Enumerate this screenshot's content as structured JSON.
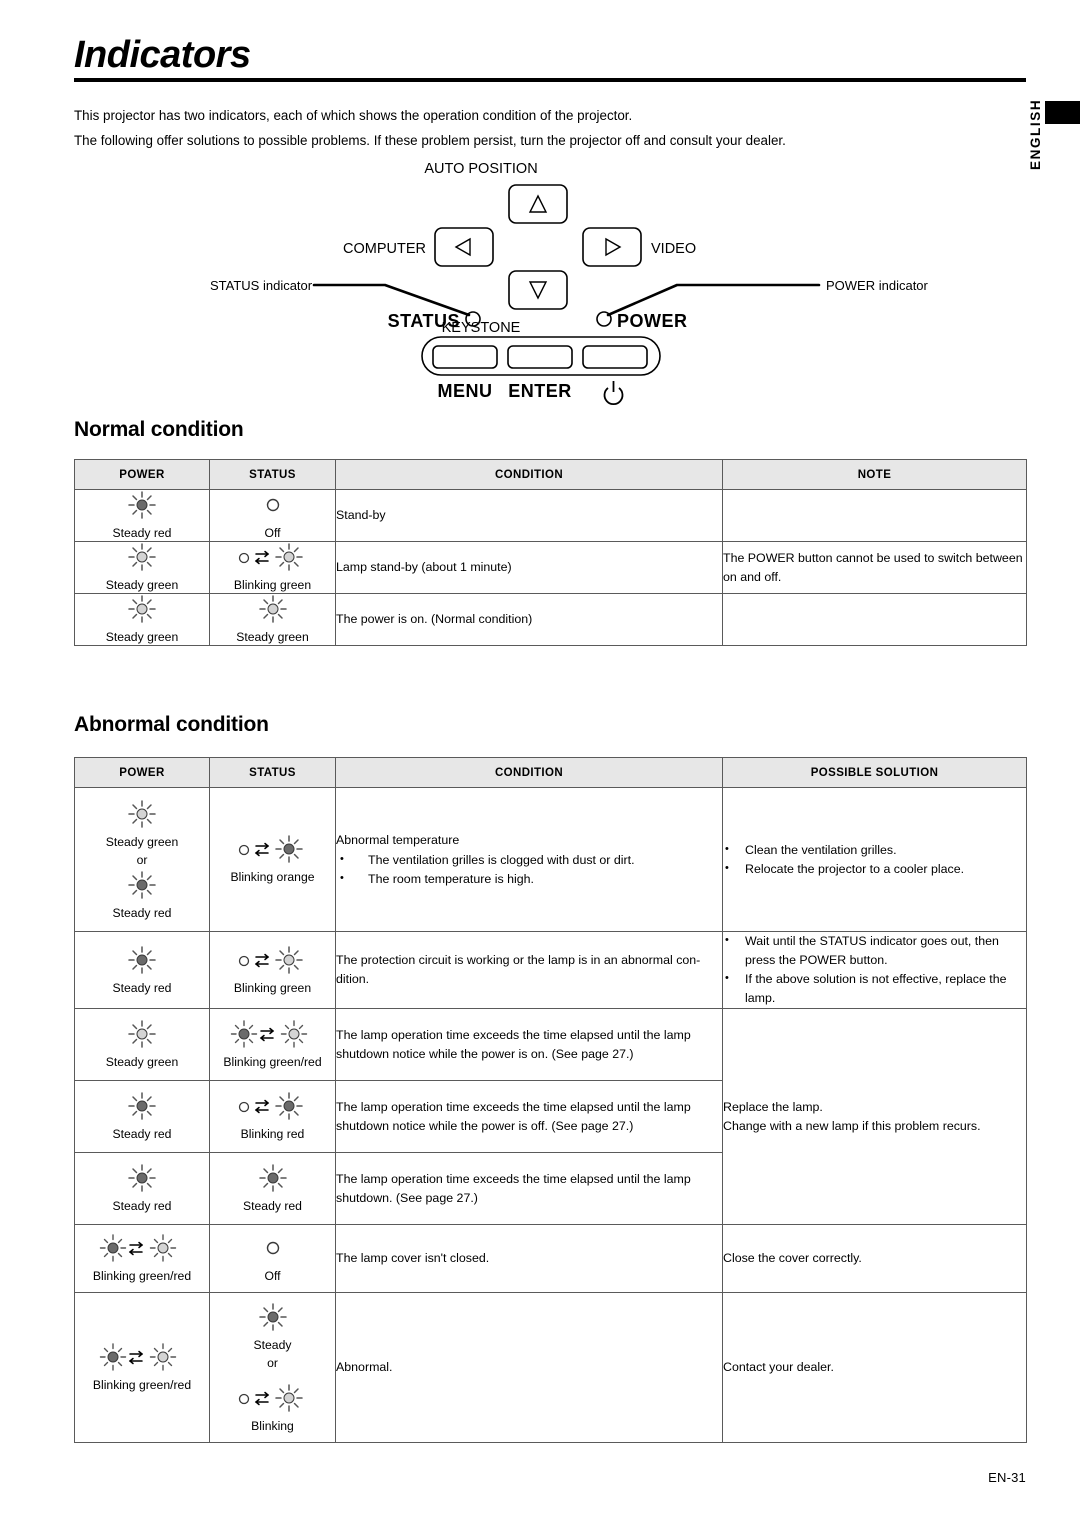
{
  "page": {
    "title": "Indicators",
    "language_tab": "ENGLISH",
    "footer": "EN-31",
    "intro": [
      "This projector has two indicators, each of which shows the operation condition of the projector.",
      "The following offer solutions to possible problems. If these problem persist, turn the projector off and consult your dealer."
    ]
  },
  "diagram": {
    "auto_position": "AUTO POSITION",
    "computer": "COMPUTER",
    "video": "VIDEO",
    "status_indicator_callout": "STATUS indicator",
    "power_indicator_callout": "POWER indicator",
    "status": "STATUS",
    "power": "POWER",
    "keystone": "KEYSTONE",
    "menu": "MENU",
    "enter": "ENTER",
    "up_arrow": "△",
    "left_arrow": "◁",
    "right_arrow": "▷",
    "down_arrow": "▽"
  },
  "normal": {
    "heading": "Normal condition",
    "columns": [
      "POWER",
      "STATUS",
      "CONDITION",
      "NOTE"
    ],
    "rows": [
      {
        "power": "Steady red",
        "status": "Off",
        "condition": "Stand-by",
        "note": ""
      },
      {
        "power": "Steady green",
        "status": "Blinking  green",
        "condition": "Lamp stand-by (about 1 minute)",
        "note": "The POWER button cannot be used to switch between on and off."
      },
      {
        "power": "Steady green",
        "status": "Steady green",
        "condition": "The power is on. (Normal condition)",
        "note": ""
      }
    ]
  },
  "abnormal": {
    "heading": "Abnormal condition",
    "columns": [
      "POWER",
      "STATUS",
      "CONDITION",
      "POSSIBLE SOLUTION"
    ],
    "rows": [
      {
        "power_a": "Steady green",
        "power_or": "or",
        "power_b": "Steady red",
        "status": "Blinking orange",
        "condition_lead": "Abnormal temperature",
        "condition_items": [
          "The ventilation grilles is clogged with dust or dirt.",
          "The room temperature is high."
        ],
        "solution_items": [
          "Clean the ventilation grilles.",
          "Relocate the projector to a cooler place."
        ]
      },
      {
        "power": "Steady red",
        "status": "Blinking  green",
        "condition": "The protection circuit is working or the lamp is in an abnormal con-dition.",
        "solution_items": [
          "Wait until the STATUS indicator goes out, then press the POWER button.",
          "If the above solution is not effective, replace the lamp."
        ]
      },
      {
        "power": "Steady green",
        "status": "Blinking green/red",
        "condition": "The lamp operation time exceeds the time elapsed until the lamp shutdown notice while the power is on. (See page 27.)",
        "solution_merged": [
          "Replace the lamp.",
          "Change with a new lamp if this problem recurs."
        ]
      },
      {
        "power": "Steady red",
        "status": "Blinking red",
        "condition": "The lamp operation time exceeds the time elapsed until the lamp shutdown notice while the power is off. (See page 27.)"
      },
      {
        "power": "Steady red",
        "status": "Steady red",
        "condition": "The lamp operation time exceeds the time elapsed until the lamp shutdown. (See page 27.)"
      },
      {
        "power": "Blinking green/red",
        "status": "Off",
        "condition": "The lamp cover isn't closed.",
        "solution": "Close the cover correctly."
      },
      {
        "power": "Blinking green/red",
        "status_a": "Steady",
        "status_or": "or",
        "status_b": "Blinking",
        "condition": "Abnormal.",
        "solution": "Contact your dealer."
      }
    ]
  },
  "colors": {
    "lit_dark": "#6b6b6b",
    "lit_light": "#d4d4d4",
    "ray": "#555555",
    "border": "#5a5a5a",
    "header_bg": "#e7e7e7"
  }
}
